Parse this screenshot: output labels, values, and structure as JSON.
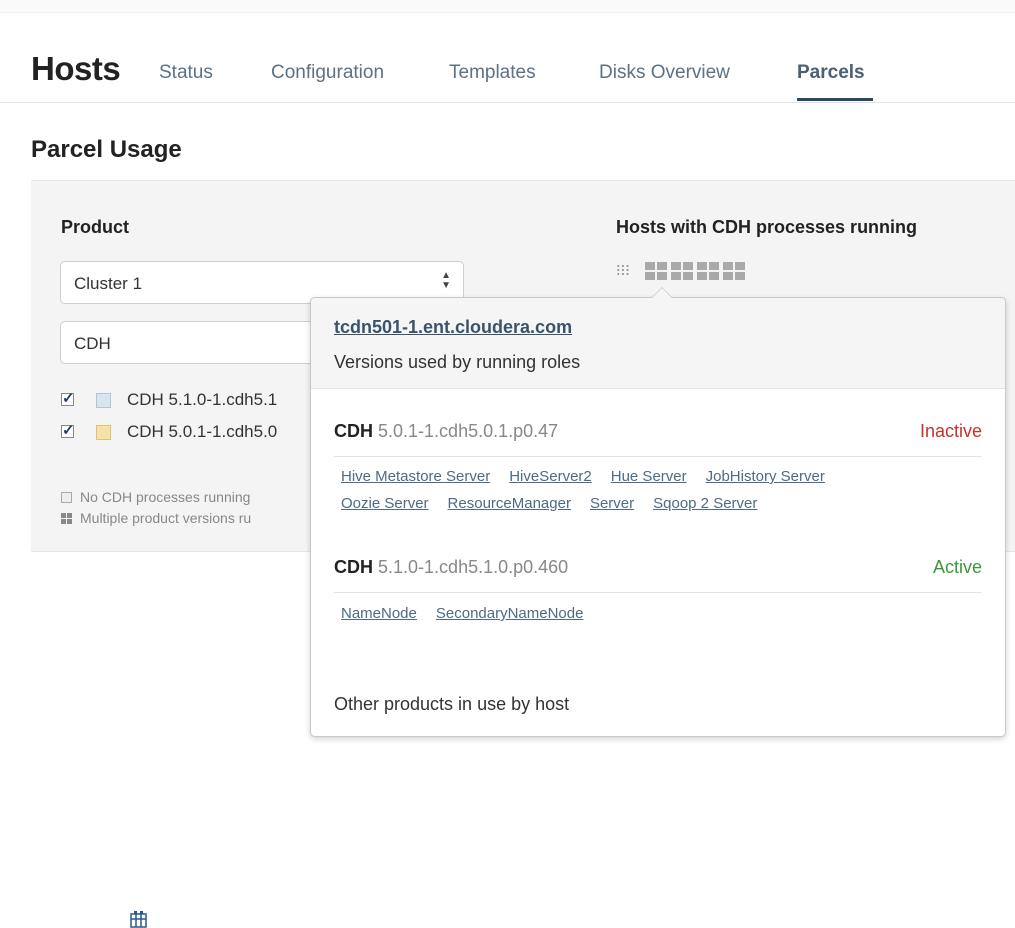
{
  "header": {
    "title": "Hosts",
    "tabs": [
      "Status",
      "Configuration",
      "Templates",
      "Disks Overview",
      "Parcels"
    ],
    "active_tab": "Parcels"
  },
  "section": {
    "title": "Parcel Usage"
  },
  "product": {
    "label": "Product",
    "cluster_select": "Cluster 1",
    "product_select": "CDH",
    "versions": [
      {
        "label": "CDH 5.1.0-1.cdh5.1",
        "checked": true,
        "color": "#d8e4ee"
      },
      {
        "label": "CDH 5.0.1-1.cdh5.0",
        "checked": true,
        "color": "#f6e2a6"
      }
    ],
    "legend": {
      "none": "No CDH processes running",
      "multiple": "Multiple product versions ru"
    }
  },
  "hosts": {
    "label": "Hosts with CDH processes running"
  },
  "popover": {
    "host": "tcdn501-1.ent.cloudera.com",
    "subtitle": "Versions used by running roles",
    "versions": [
      {
        "product": "CDH",
        "version": "5.0.1-1.cdh5.0.1.p0.47",
        "state": "Inactive",
        "state_color": "#c9302c",
        "roles": [
          "Hive Metastore Server",
          "HiveServer2",
          "Hue Server",
          "JobHistory Server",
          "Oozie Server",
          "ResourceManager",
          "Server",
          "Sqoop 2 Server"
        ]
      },
      {
        "product": "CDH",
        "version": "5.1.0-1.cdh5.1.0.p0.460",
        "state": "Active",
        "state_color": "#3a9a3a",
        "roles": [
          "NameNode",
          "SecondaryNameNode"
        ]
      }
    ],
    "footer": "Other products in use by host"
  },
  "colors": {
    "link": "#4d6a86",
    "accent": "#2a4a62"
  }
}
